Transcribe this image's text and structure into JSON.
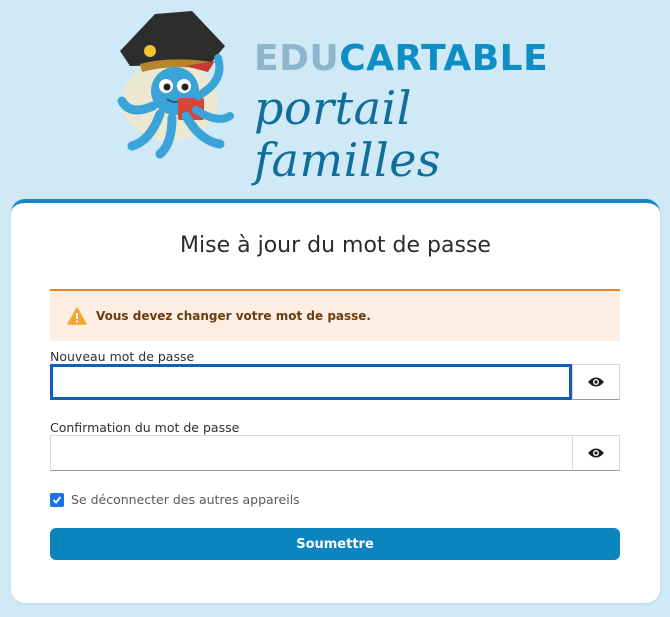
{
  "header": {
    "brand_part1": "EDU",
    "brand_part2": "CARTABLE",
    "subtitle": "portail familles",
    "mascot_icon": "pirate-octopus-mascot"
  },
  "form": {
    "title": "Mise à jour du mot de passe",
    "alert": {
      "icon": "warning-icon",
      "message": "Vous devez changer votre mot de passe."
    },
    "new_password": {
      "label": "Nouveau mot de passe",
      "value": "",
      "toggle_icon": "eye-icon"
    },
    "confirm_password": {
      "label": "Confirmation du mot de passe",
      "value": "",
      "toggle_icon": "eye-icon"
    },
    "logout_others": {
      "label": "Se déconnecter des autres appareils",
      "checked": true
    },
    "submit_label": "Soumettre"
  },
  "colors": {
    "background": "#cfe9f6",
    "accent": "#0c85bf",
    "alert_bg": "#fdeee3",
    "alert_border": "#e9832a",
    "focus": "#1060b8"
  }
}
